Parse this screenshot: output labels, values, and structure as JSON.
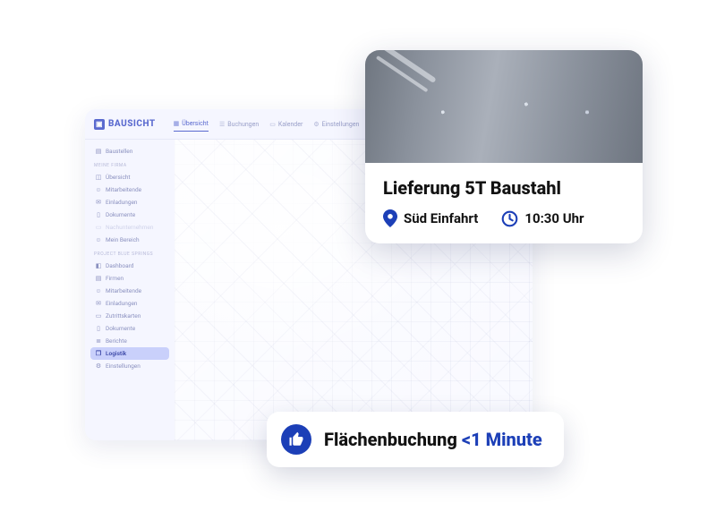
{
  "colors": {
    "accent": "#1c3fb7",
    "sidebar_active": "#c9d0fb"
  },
  "app": {
    "brand": "BAUSICHT",
    "tabs": [
      {
        "label": "Übersicht",
        "active": true
      },
      {
        "label": "Buchungen",
        "active": false
      },
      {
        "label": "Kalender",
        "active": false
      },
      {
        "label": "Einstellungen",
        "active": false
      }
    ]
  },
  "sidebar": {
    "top": [
      {
        "icon": "building-icon",
        "label": "Baustellen"
      }
    ],
    "section1_title": "MEINE FIRMA",
    "section1": [
      {
        "icon": "overview-icon",
        "label": "Übersicht"
      },
      {
        "icon": "people-icon",
        "label": "Mitarbeitende"
      },
      {
        "icon": "mail-icon",
        "label": "Einladungen"
      },
      {
        "icon": "doc-icon",
        "label": "Dokumente"
      },
      {
        "icon": "sub-icon",
        "label": "Nachunternehmen",
        "muted": true
      },
      {
        "icon": "user-icon",
        "label": "Mein Bereich"
      }
    ],
    "section2_title": "PROJECT BLUE SPRINGS",
    "section2": [
      {
        "icon": "dashboard-icon",
        "label": "Dashboard"
      },
      {
        "icon": "company-icon",
        "label": "Firmen"
      },
      {
        "icon": "people-icon",
        "label": "Mitarbeitende"
      },
      {
        "icon": "mail-icon",
        "label": "Einladungen"
      },
      {
        "icon": "card-icon",
        "label": "Zutrittskarten"
      },
      {
        "icon": "doc-icon",
        "label": "Dokumente"
      },
      {
        "icon": "report-icon",
        "label": "Berichte"
      },
      {
        "icon": "truck-icon",
        "label": "Logistik",
        "active": true
      },
      {
        "icon": "gear-icon",
        "label": "Einstellungen"
      }
    ]
  },
  "delivery": {
    "title": "Lieferung 5T Baustahl",
    "location": "Süd Einfahrt",
    "time": "10:30 Uhr"
  },
  "badge": {
    "text": "Flächenbuchung",
    "highlight": "<1 Minute"
  }
}
